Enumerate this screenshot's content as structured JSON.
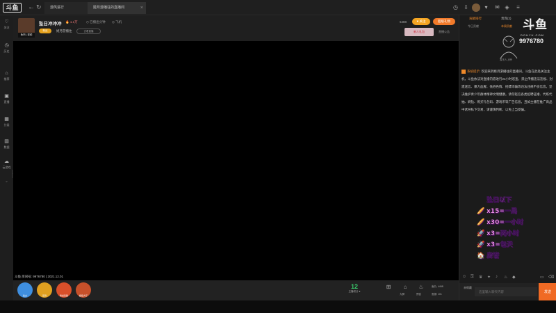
{
  "titlebar": {
    "logo": "斗鱼",
    "tabs": [
      {
        "label": "游风进行"
      },
      {
        "label": "姬月游播往的直播间"
      }
    ],
    "close": "×"
  },
  "sidebar": {
    "items": [
      {
        "label": "关注",
        "icon": "heart-icon"
      },
      {
        "label": "历史",
        "icon": "clock-icon"
      },
      {
        "label": "推荐",
        "icon": "home-icon"
      },
      {
        "label": "直播",
        "icon": "play-icon"
      },
      {
        "label": "分类",
        "icon": "grid-icon"
      },
      {
        "label": "数据",
        "icon": "chart-icon"
      },
      {
        "label": "云游戏",
        "icon": "cloud-icon"
      }
    ]
  },
  "room": {
    "host_label": "鱼吧 | 视频",
    "title": "坠日冲冲冲",
    "hot": "🔥 1.1万",
    "meta1": "◷ 已播出分钟",
    "meta2": "◎ 飞机",
    "fans_badge": "粉丝",
    "host_name": "姬月游播往",
    "sub_label": "去看直播",
    "follow_count": "5488",
    "follow_label": "关注",
    "gift_label": "超级礼物",
    "banner_label": "新人礼包",
    "report_label": "直播公告"
  },
  "video": {
    "footer": "斗鱼 房间号: 9976780 | 2021.12.01"
  },
  "bottombar": {
    "buttons": [
      {
        "label": "鱼丸",
        "color": "#3f8fe0"
      },
      {
        "label": "签到",
        "color": "#e0a020"
      },
      {
        "label": "粉丝奖励",
        "color": "#d84f2a"
      },
      {
        "label": "超级大厅",
        "color": "#c6502a"
      }
    ],
    "level": "12",
    "level_label": "主播积分 ●",
    "right_labels": [
      "大屏",
      "预告"
    ],
    "stats": [
      "鱼丸: 4468",
      "鱼翅: 101"
    ]
  },
  "rightpanel": {
    "tabs": [
      "贡献排行",
      "贵宾(2)"
    ],
    "subtabs": [
      "今日贡献",
      "本周贡献",
      "总榜"
    ],
    "rank_caption": "暂无人上榜",
    "brand": "斗鱼",
    "brand_sub": "DOUYU.COM",
    "room_number": "9976780",
    "system_tag": "系统提示:",
    "system_text": "欢迎来到姬月游播往的直播间。斗鱼在此处关注主机，斗鱼依法对直播内容进行24小时巡查，禁止传播违法违规、封建迷信、暴力血腥、低俗色情、招嫖诈骗等违法违规不良信息。坚决维护青少年群体精神文明健康。请勿轻信各类招聘征婚、代练代抽、刷钻、购买礼包码、游戏币等广告信息，且如主播在推广商品中诱导私下交易，请谨慎判断，以免上当受骗。",
    "overlay": [
      {
        "icon": "",
        "text": "坠日以下"
      },
      {
        "icon": "🥖",
        "text": "x15=一局"
      },
      {
        "icon": "🥖",
        "text": "x30=一小时"
      },
      {
        "icon": "🚀",
        "text": "x3=两小时"
      },
      {
        "icon": "🚀",
        "text": "x3=包天"
      },
      {
        "icon": "🏠",
        "text": "房管"
      }
    ],
    "input_placeholder": "这里输入聊天内容",
    "input_avatar_label": "未佩戴",
    "send_label": "发送"
  }
}
